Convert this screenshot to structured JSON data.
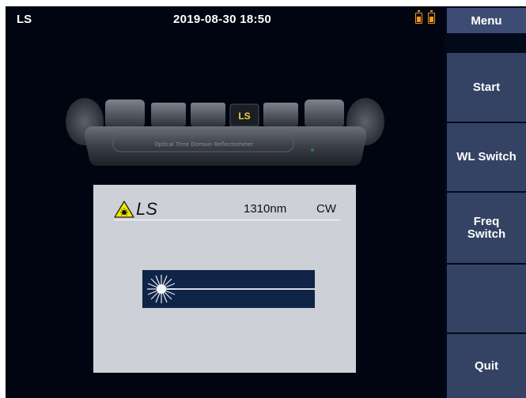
{
  "status": {
    "mode": "LS",
    "datetime": "2019-08-30 18:50",
    "battery_color": "#f29a1a"
  },
  "device": {
    "module_label": "LS",
    "caption": "Optical Time Domain Reflectometer"
  },
  "panel": {
    "title": "LS",
    "wavelength": "1310nm",
    "mode": "CW",
    "warning_icon": "laser-warning-icon"
  },
  "menu": {
    "title": "Menu",
    "buttons": [
      "Start",
      "WL Switch",
      "Freq\nSwitch",
      "",
      "Quit"
    ]
  },
  "colors": {
    "background": "#000511",
    "menu_button": "#344264",
    "panel": "#cdd0d6",
    "beam": "#0f2447",
    "accent": "#f0d23c"
  }
}
